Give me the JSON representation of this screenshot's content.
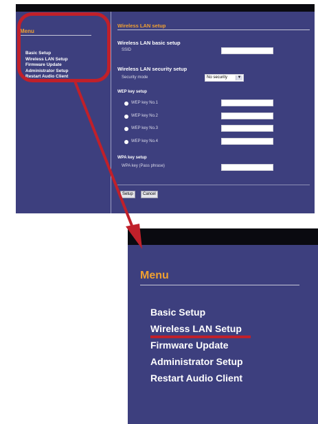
{
  "menu": {
    "title": "Menu",
    "items": [
      {
        "label": "Basic Setup"
      },
      {
        "label": "Wireless LAN Setup"
      },
      {
        "label": "Firmware Update"
      },
      {
        "label": "Administrator Setup"
      },
      {
        "label": "Restart Audio Client"
      }
    ]
  },
  "page": {
    "title": "Wireless LAN setup",
    "basic_section": "Wireless LAN basic setup",
    "ssid_label": "SSID",
    "ssid_value": "",
    "security_section": "Wireless LAN security setup",
    "security_mode_label": "Security mode",
    "security_mode_value": "No security",
    "wep_section": "WEP key setup",
    "wep_keys": [
      {
        "label": "WEP key No.1",
        "value": ""
      },
      {
        "label": "WEP key No.2",
        "value": ""
      },
      {
        "label": "WEP key No.3",
        "value": ""
      },
      {
        "label": "WEP key No.4",
        "value": ""
      }
    ],
    "wpa_section": "WPA key setup",
    "wpa_key_label": "WPA key (Pass phrase)",
    "wpa_key_value": "",
    "setup_button": "Setup",
    "cancel_button": "Cancel"
  },
  "colors": {
    "background": "#3d3f7e",
    "accent_orange": "#f0a030",
    "highlight_red": "#c0202a"
  },
  "icons": {
    "dropdown": "chevron-down-icon",
    "radio": "radio-button-icon",
    "pointer": "arrow-icon"
  }
}
